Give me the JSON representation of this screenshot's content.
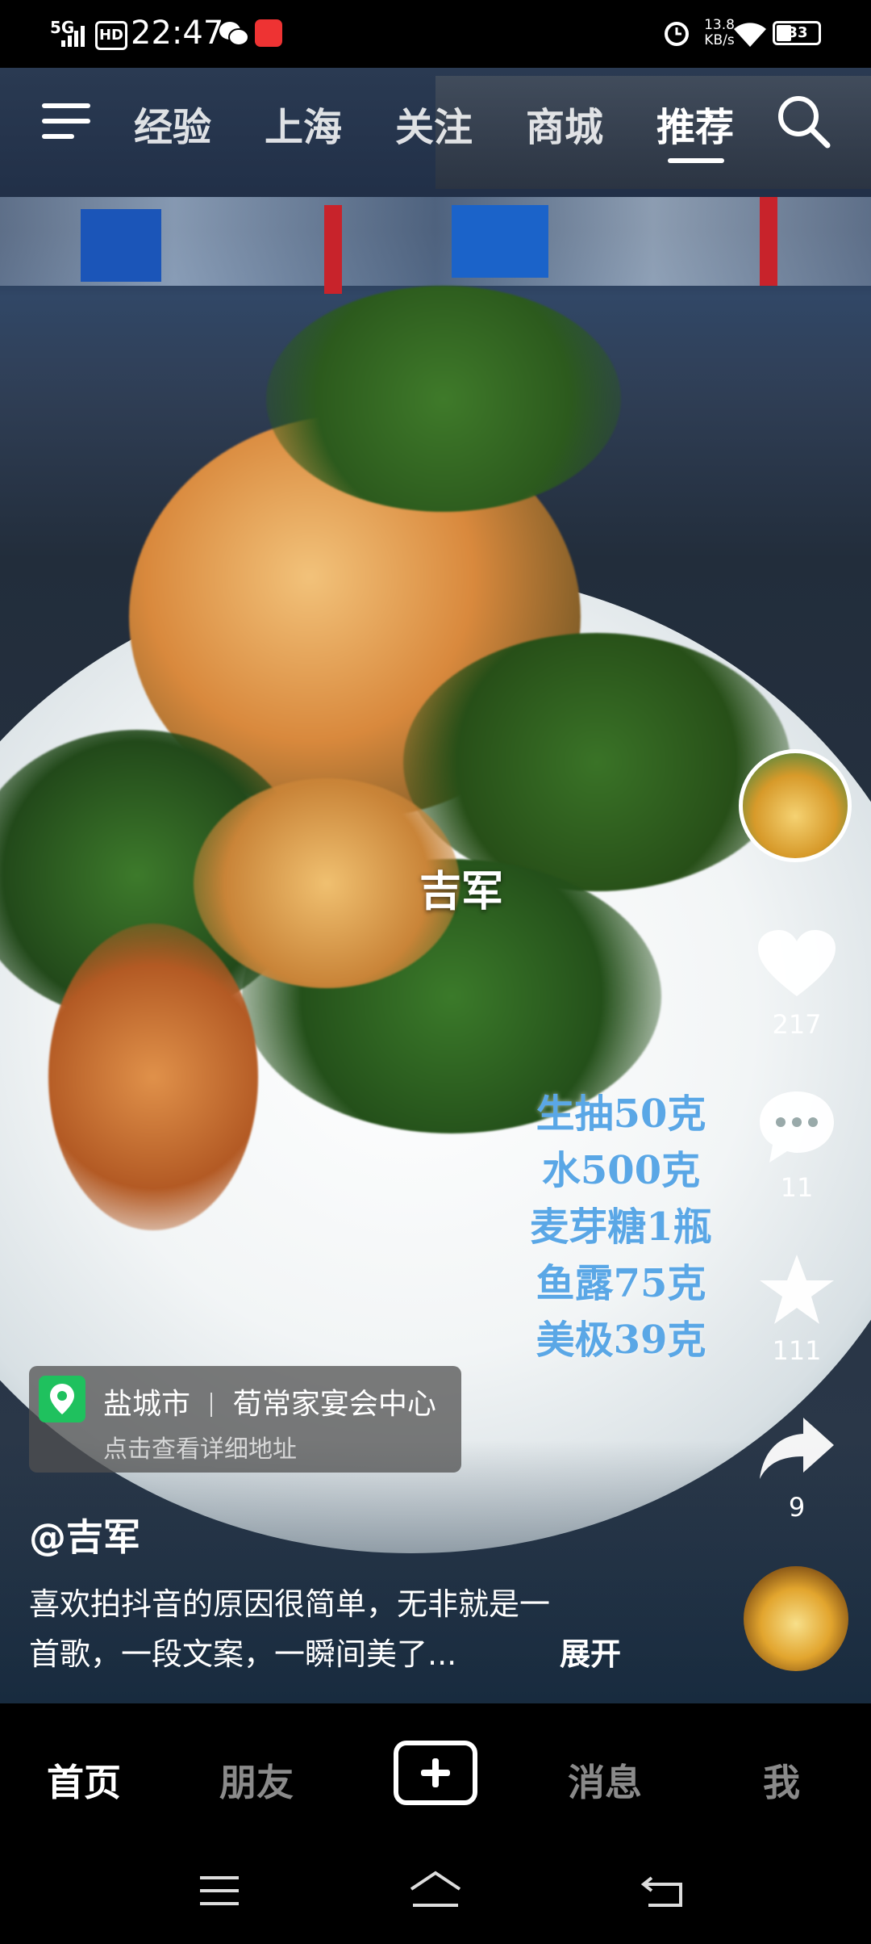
{
  "status_bar": {
    "network": "5G",
    "hd": "HD",
    "time": "22:47",
    "net_speed_value": "13.8",
    "net_speed_unit": "KB/s",
    "battery": "33"
  },
  "top_nav": {
    "tabs": [
      "经验",
      "上海",
      "关注",
      "商城",
      "推荐"
    ],
    "active_index": 4
  },
  "video": {
    "watermark": "吉军",
    "recipe_lines": [
      "生抽50克",
      "水500克",
      "麦芽糖1瓶",
      "鱼露75克",
      "美极39克"
    ]
  },
  "side_actions": {
    "likes": "217",
    "comments": "11",
    "favorites": "111",
    "shares": "9"
  },
  "location": {
    "city": "盐城市",
    "venue": "荀常家宴会中心",
    "hint": "点击查看详细地址"
  },
  "post": {
    "author": "@吉军",
    "caption_line1": "喜欢拍抖音的原因很简单，无非就是一",
    "caption_line2": "首歌，一段文案，一瞬间美了...",
    "expand": "展开"
  },
  "bottom_nav": {
    "home": "首页",
    "friends": "朋友",
    "messages": "消息",
    "me": "我"
  },
  "colors": {
    "recipe_text": "#5aa7e6",
    "location_pin": "#1fc15e"
  }
}
